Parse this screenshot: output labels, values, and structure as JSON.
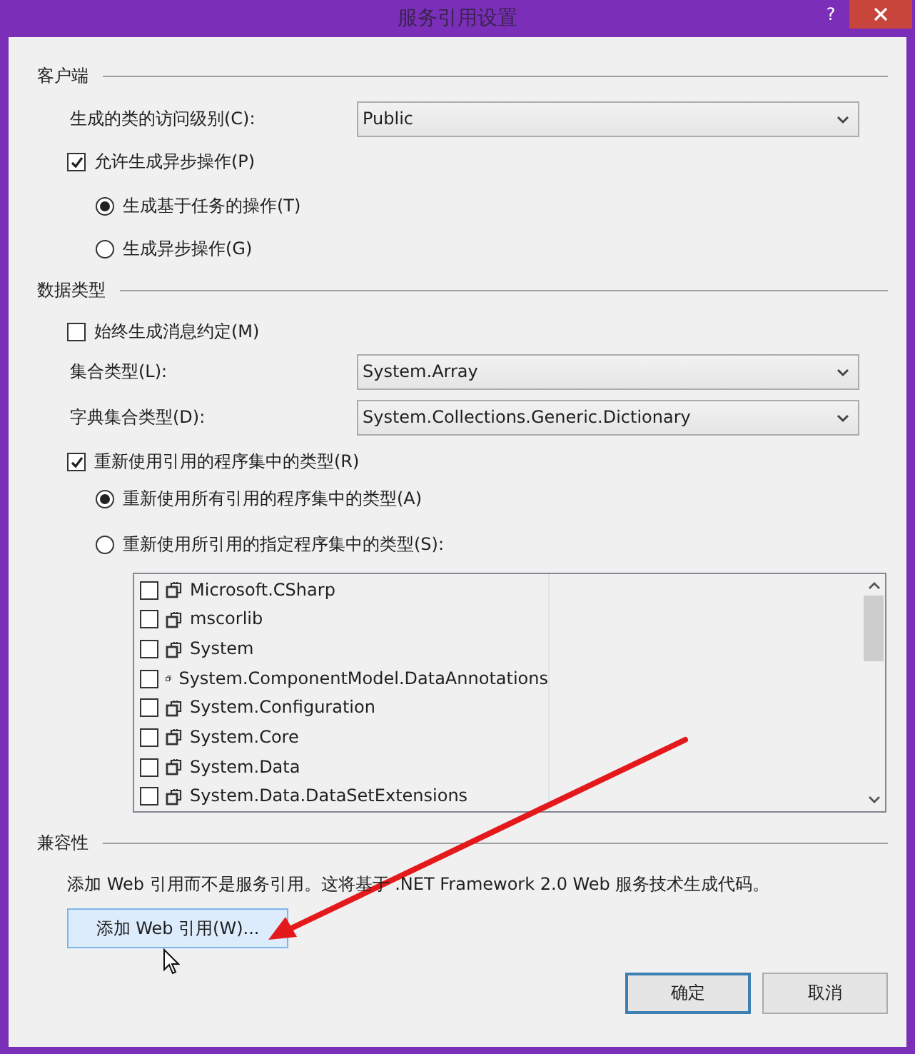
{
  "window": {
    "title": "服务引用设置",
    "help": "?"
  },
  "client": {
    "heading": "客户端",
    "access_level": {
      "label": "生成的类的访问级别(C):",
      "value": "Public"
    },
    "allow_async": {
      "label": "允许生成异步操作(P)",
      "checked": true
    },
    "async_modes": [
      {
        "label": "生成基于任务的操作(T)",
        "selected": true
      },
      {
        "label": "生成异步操作(G)",
        "selected": false
      }
    ]
  },
  "data_type": {
    "heading": "数据类型",
    "always_contracts": {
      "label": "始终生成消息约定(M)",
      "checked": false
    },
    "collection_type": {
      "label": "集合类型(L):",
      "value": "System.Array"
    },
    "dictionary_type": {
      "label": "字典集合类型(D):",
      "value": "System.Collections.Generic.Dictionary"
    },
    "reuse_types": {
      "label": "重新使用引用的程序集中的类型(R)",
      "checked": true
    },
    "reuse_modes": [
      {
        "label": "重新使用所有引用的程序集中的类型(A)",
        "selected": true
      },
      {
        "label": "重新使用所引用的指定程序集中的类型(S):",
        "selected": false
      }
    ],
    "assemblies": [
      {
        "name": "Microsoft.CSharp",
        "checked": false
      },
      {
        "name": "mscorlib",
        "checked": false
      },
      {
        "name": "System",
        "checked": false
      },
      {
        "name": "System.ComponentModel.DataAnnotations",
        "checked": false
      },
      {
        "name": "System.Configuration",
        "checked": false
      },
      {
        "name": "System.Core",
        "checked": false
      },
      {
        "name": "System.Data",
        "checked": false
      },
      {
        "name": "System.Data.DataSetExtensions",
        "checked": false
      }
    ]
  },
  "compatibility": {
    "heading": "兼容性",
    "description": "添加 Web 引用而不是服务引用。这将基于 .NET Framework 2.0 Web 服务技术生成代码。",
    "button": "添加 Web 引用(W)..."
  },
  "buttons": [
    {
      "label": "确定",
      "default": true
    },
    {
      "label": "取消",
      "default": false
    }
  ]
}
